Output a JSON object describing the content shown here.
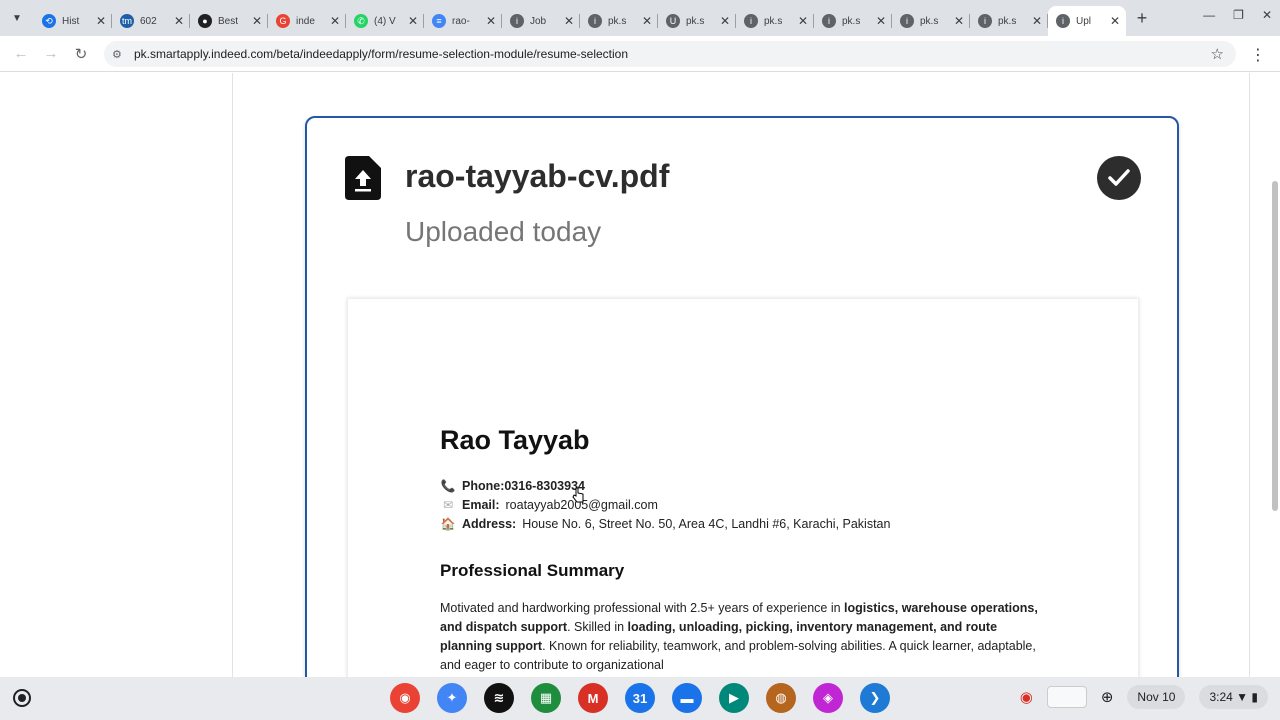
{
  "browser": {
    "tabs": [
      {
        "title": "Hist",
        "fav_color": "#1a73e8",
        "fav_glyph": "⟲"
      },
      {
        "title": "602",
        "fav_color": "#1f5fa8",
        "fav_glyph": "tm"
      },
      {
        "title": "Best",
        "fav_color": "#202124",
        "fav_glyph": "●"
      },
      {
        "title": "inde",
        "fav_color": "#ea4335",
        "fav_glyph": "G"
      },
      {
        "title": "(4) V",
        "fav_color": "#25d366",
        "fav_glyph": "✆"
      },
      {
        "title": "rao-",
        "fav_color": "#4285f4",
        "fav_glyph": "≡"
      },
      {
        "title": "Job",
        "fav_color": "#5f6368",
        "fav_glyph": "i"
      },
      {
        "title": "pk.s",
        "fav_color": "#5f6368",
        "fav_glyph": "i"
      },
      {
        "title": "pk.s",
        "fav_color": "#5f6368",
        "fav_glyph": "U"
      },
      {
        "title": "pk.s",
        "fav_color": "#5f6368",
        "fav_glyph": "i"
      },
      {
        "title": "pk.s",
        "fav_color": "#5f6368",
        "fav_glyph": "i"
      },
      {
        "title": "pk.s",
        "fav_color": "#5f6368",
        "fav_glyph": "i"
      },
      {
        "title": "pk.s",
        "fav_color": "#5f6368",
        "fav_glyph": "i"
      },
      {
        "title": "Upl",
        "fav_color": "#5f6368",
        "fav_glyph": "i",
        "active": true
      }
    ],
    "url": "pk.smartapply.indeed.com/beta/indeedapply/form/resume-selection-module/resume-selection"
  },
  "resume": {
    "file_name": "rao-tayyab-cv.pdf",
    "uploaded_label": "Uploaded today",
    "cv": {
      "name": "Rao Tayyab",
      "phone_label": "Phone:",
      "phone": "0316-8303934",
      "email_label": "Email:",
      "email": "roatayyab2005@gmail.com",
      "address_label": "Address:",
      "address": "House No. 6, Street No. 50, Area 4C, Landhi #6, Karachi, Pakistan",
      "section_title": "Professional Summary",
      "summary_1": "Motivated and hardworking professional with 2.5+ years of experience in ",
      "summary_b1": "logistics, warehouse operations, and dispatch support",
      "summary_2": ". Skilled in ",
      "summary_b2": "loading, unloading, picking, inventory management, and route planning support",
      "summary_3": ". Known for reliability, teamwork, and problem-solving abilities. A quick learner, adaptable, and eager to contribute to organizational"
    }
  },
  "shelf": {
    "apps": [
      {
        "name": "chrome",
        "color": "#ea4335",
        "glyph": "◉"
      },
      {
        "name": "gemini",
        "color": "#4285f4",
        "glyph": "✦"
      },
      {
        "name": "spotify",
        "color": "#111111",
        "glyph": "≋"
      },
      {
        "name": "sheets-grid",
        "color": "#1e8e3e",
        "glyph": "▦"
      },
      {
        "name": "gmail",
        "color": "#d93025",
        "glyph": "M"
      },
      {
        "name": "calendar",
        "color": "#1a73e8",
        "glyph": "31"
      },
      {
        "name": "files",
        "color": "#1a73e8",
        "glyph": "▬"
      },
      {
        "name": "meet",
        "color": "#00897b",
        "glyph": "▶"
      },
      {
        "name": "app-orange",
        "color": "#b5651d",
        "glyph": "◍"
      },
      {
        "name": "app-pink",
        "color": "#c026d3",
        "glyph": "◈"
      },
      {
        "name": "vscode",
        "color": "#1f7ad6",
        "glyph": "❯"
      }
    ],
    "date": "Nov 10",
    "time": "3:24"
  }
}
